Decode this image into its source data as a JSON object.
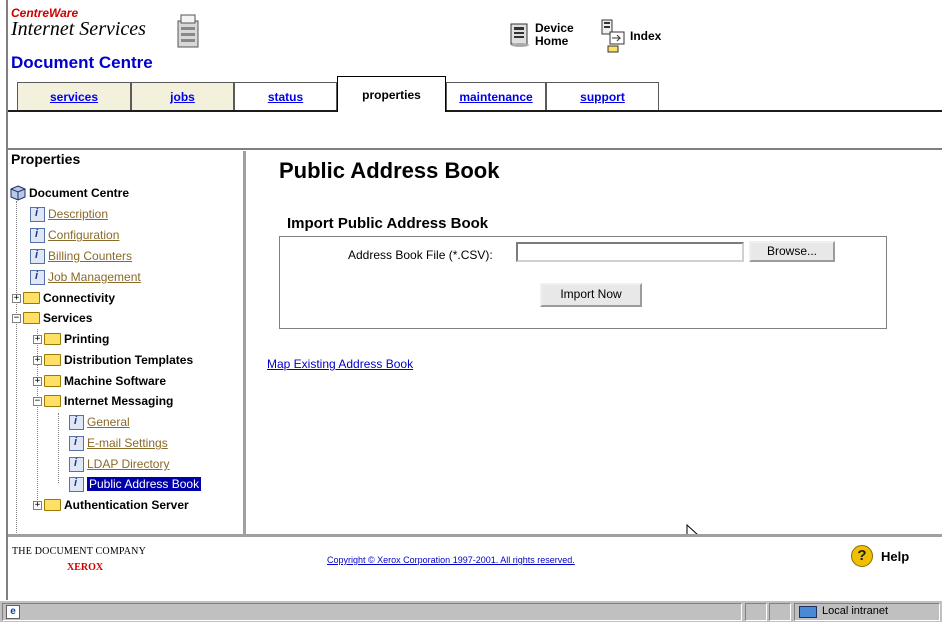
{
  "header": {
    "brand_top": "CentreWare",
    "brand_sub": "Internet Services",
    "device_name": "Document Centre",
    "device_home_label": "Device Home",
    "index_label": "Index"
  },
  "tabs": [
    {
      "label": "services"
    },
    {
      "label": "jobs"
    },
    {
      "label": "status"
    },
    {
      "label": "properties",
      "active": true
    },
    {
      "label": "maintenance"
    },
    {
      "label": "support"
    }
  ],
  "sidebar": {
    "title": "Properties",
    "root": "Document Centre",
    "items": [
      {
        "label": "Description"
      },
      {
        "label": "Configuration"
      },
      {
        "label": "Billing Counters"
      },
      {
        "label": "Job Management"
      },
      {
        "label": "Connectivity"
      },
      {
        "label": "Services"
      },
      {
        "label": "Printing"
      },
      {
        "label": "Distribution Templates"
      },
      {
        "label": "Machine Software"
      },
      {
        "label": "Internet Messaging"
      },
      {
        "label": "General"
      },
      {
        "label": "E-mail Settings"
      },
      {
        "label": "LDAP Directory"
      },
      {
        "label": "Public Address Book",
        "selected": true
      },
      {
        "label": "Authentication Server"
      }
    ]
  },
  "main": {
    "title": "Public Address Book",
    "section_title": "Import Public Address Book",
    "file_label": "Address Book File (*.CSV):",
    "file_value": "",
    "browse_label": "Browse...",
    "import_label": "Import Now",
    "map_link": "Map Existing Address Book"
  },
  "footer": {
    "company_line": "THE DOCUMENT COMPANY",
    "company_brand": "XEROX",
    "copyright": "Copyright © Xerox Corporation 1997-2001. All rights reserved.",
    "help_label": "Help"
  },
  "statusbar": {
    "zone": "Local intranet"
  },
  "colors": {
    "tab_bg": "#f3f0dc",
    "link": "#0000cc",
    "sidebar_link": "#8a6a2a",
    "selection": "#0000a8",
    "brand_red": "#cc0000"
  }
}
